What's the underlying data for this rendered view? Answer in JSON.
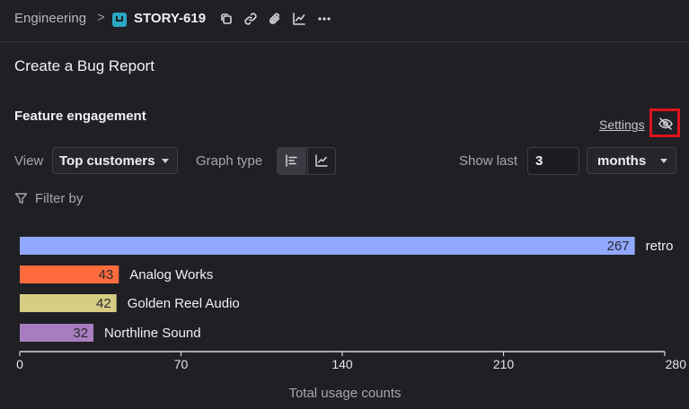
{
  "breadcrumb": {
    "project": "Engineering",
    "separator": ">",
    "story_id": "STORY-619"
  },
  "page": {
    "title": "Create a Bug Report"
  },
  "section": {
    "title": "Feature engagement",
    "settings_label": "Settings"
  },
  "controls": {
    "view_label": "View",
    "view_value": "Top customers",
    "graph_type_label": "Graph type",
    "show_last_label": "Show last",
    "show_last_value": "3",
    "period_value": "months",
    "filter_label": "Filter by"
  },
  "icons": {
    "toolbar": [
      "copy-icon",
      "link-icon",
      "attachment-icon",
      "chart-icon",
      "more-icon"
    ],
    "graph_types": [
      "bar-chart-icon",
      "line-chart-icon"
    ],
    "hide": "eye-off-icon",
    "filter": "filter-icon"
  },
  "chart_data": {
    "type": "bar",
    "orientation": "horizontal",
    "categories": [
      "retro",
      "Analog Works",
      "Golden Reel Audio",
      "Northline Sound"
    ],
    "values": [
      267,
      43,
      42,
      32
    ],
    "colors": [
      "#90a8ff",
      "#ff6b3d",
      "#d6cc82",
      "#a77dbf"
    ],
    "xlim": [
      0,
      280
    ],
    "xticks": [
      0,
      70,
      140,
      210,
      280
    ],
    "xlabel": "Total usage counts"
  }
}
